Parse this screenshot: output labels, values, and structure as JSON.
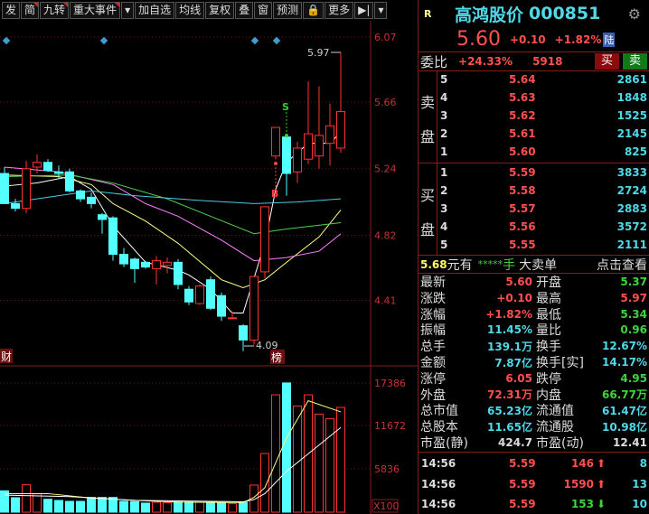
{
  "toolbar": {
    "items": [
      "发",
      "简",
      "九转",
      "重大事件",
      "▾",
      "加自选",
      "均线",
      "复权",
      "叠",
      "窗",
      "预测",
      "🔒",
      "更多",
      "▶|",
      "▾"
    ]
  },
  "stock": {
    "badge": "R",
    "name": "高鸿股价",
    "code": "000851",
    "price": "5.60",
    "change": "+0.10",
    "change_pct": "+1.82%",
    "tag": "陆"
  },
  "weibi": {
    "label": "委比",
    "pct": "+24.33%",
    "diff": "5918",
    "buy": "买",
    "sell": "卖"
  },
  "orderbook": {
    "sell_label": [
      "卖",
      "盘"
    ],
    "buy_label": [
      "买",
      "盘"
    ],
    "sell": [
      {
        "lvl": "5",
        "price": "5.64",
        "vol": "2861"
      },
      {
        "lvl": "4",
        "price": "5.63",
        "vol": "1848"
      },
      {
        "lvl": "3",
        "price": "5.62",
        "vol": "1525"
      },
      {
        "lvl": "2",
        "price": "5.61",
        "vol": "2145"
      },
      {
        "lvl": "1",
        "price": "5.60",
        "vol": "825"
      }
    ],
    "buy": [
      {
        "lvl": "1",
        "price": "5.59",
        "vol": "3833"
      },
      {
        "lvl": "2",
        "price": "5.58",
        "vol": "2724"
      },
      {
        "lvl": "3",
        "price": "5.57",
        "vol": "2883"
      },
      {
        "lvl": "4",
        "price": "5.56",
        "vol": "3572"
      },
      {
        "lvl": "5",
        "price": "5.55",
        "vol": "2111"
      }
    ]
  },
  "bigorder": {
    "price": "5.68",
    "text1": "元有",
    "stars": "*****",
    "text2": "手",
    "text3": "大卖单",
    "link": "点击查看"
  },
  "stats": [
    {
      "l1": "最新",
      "v1": "5.60",
      "c1": "red",
      "l2": "开盘",
      "v2": "5.37",
      "c2": "grn"
    },
    {
      "l1": "涨跌",
      "v1": "+0.10",
      "c1": "red",
      "l2": "最高",
      "v2": "5.97",
      "c2": "red"
    },
    {
      "l1": "涨幅",
      "v1": "+1.82%",
      "c1": "red",
      "l2": "最低",
      "v2": "5.34",
      "c2": "grn"
    },
    {
      "l1": "振幅",
      "v1": "11.45%",
      "c1": "cyan",
      "l2": "量比",
      "v2": "0.96",
      "c2": "grn"
    },
    {
      "l1": "总手",
      "v1": "139.1万",
      "c1": "cyan",
      "l2": "换手",
      "v2": "12.67%",
      "c2": "cyan"
    },
    {
      "l1": "金额",
      "v1": "7.87亿",
      "c1": "cyan",
      "l2": "换手[实]",
      "v2": "14.17%",
      "c2": "cyan"
    },
    {
      "l1": "涨停",
      "v1": "6.05",
      "c1": "red",
      "l2": "跌停",
      "v2": "4.95",
      "c2": "grn"
    },
    {
      "l1": "外盘",
      "v1": "72.31万",
      "c1": "red",
      "l2": "内盘",
      "v2": "66.77万",
      "c2": "grn"
    },
    {
      "l1": "总市值",
      "v1": "65.23亿",
      "c1": "cyan",
      "l2": "流通值",
      "v2": "61.47亿",
      "c2": "cyan"
    },
    {
      "l1": "总股本",
      "v1": "11.65亿",
      "c1": "cyan",
      "l2": "流通股",
      "v2": "10.98亿",
      "c2": "cyan"
    },
    {
      "l1": "市盈(静)",
      "v1": "424.7",
      "c1": "wht",
      "l2": "市盈(动)",
      "v2": "12.41",
      "c2": "wht"
    }
  ],
  "ticks": [
    {
      "time": "14:56",
      "price": "5.59",
      "vol": "146",
      "dir": "up",
      "n": "8"
    },
    {
      "time": "14:56",
      "price": "5.59",
      "vol": "1590",
      "dir": "up",
      "n": "13"
    },
    {
      "time": "14:56",
      "price": "5.59",
      "vol": "153",
      "dir": "down",
      "n": "10"
    }
  ],
  "colors": {
    "up": "#ff3232",
    "down": "#54ffff",
    "axis": "#c83232"
  },
  "chart_data": {
    "type": "candlestick",
    "price_ticks": [
      "6.07",
      "5.66",
      "5.24",
      "4.82",
      "4.41"
    ],
    "price_range": [
      4.0,
      6.07
    ],
    "high_label": "5.97",
    "low_label": "4.09",
    "signals": {
      "buy": "B",
      "sell": "S"
    },
    "markers": {
      "cai": "财",
      "bang": "榜"
    },
    "candles": [
      [
        5.21,
        5.25,
        5.02,
        5.02
      ],
      [
        5.02,
        5.05,
        4.97,
        4.99
      ],
      [
        4.99,
        5.29,
        4.96,
        5.24
      ],
      [
        5.25,
        5.33,
        5.21,
        5.28
      ],
      [
        5.28,
        5.3,
        5.22,
        5.23
      ],
      [
        5.22,
        5.26,
        5.18,
        5.21
      ],
      [
        5.22,
        5.24,
        5.09,
        5.1
      ],
      [
        5.1,
        5.11,
        5.03,
        5.05
      ],
      [
        5.06,
        5.09,
        4.99,
        5.02
      ],
      [
        4.95,
        4.96,
        4.83,
        4.92
      ],
      [
        4.93,
        4.94,
        4.66,
        4.7
      ],
      [
        4.7,
        4.74,
        4.62,
        4.64
      ],
      [
        4.67,
        4.68,
        4.52,
        4.61
      ],
      [
        4.65,
        4.66,
        4.61,
        4.62
      ],
      [
        4.61,
        4.69,
        4.51,
        4.66
      ],
      [
        4.63,
        4.68,
        4.58,
        4.65
      ],
      [
        4.65,
        4.67,
        4.48,
        4.51
      ],
      [
        4.48,
        4.5,
        4.38,
        4.4
      ],
      [
        4.39,
        4.51,
        4.38,
        4.5
      ],
      [
        4.54,
        4.56,
        4.35,
        4.36
      ],
      [
        4.44,
        4.46,
        4.28,
        4.31
      ],
      [
        4.3,
        4.34,
        4.3,
        4.3
      ],
      [
        4.25,
        4.26,
        4.09,
        4.16
      ],
      [
        4.16,
        4.56,
        4.13,
        4.56
      ],
      [
        4.59,
        5.0,
        4.55,
        5.0
      ],
      [
        5.32,
        5.5,
        5.3,
        5.5
      ],
      [
        5.44,
        5.45,
        5.07,
        5.21
      ],
      [
        5.22,
        5.41,
        5.15,
        5.37
      ],
      [
        5.3,
        5.79,
        5.27,
        5.46
      ],
      [
        5.32,
        5.76,
        5.24,
        5.45
      ],
      [
        5.4,
        5.65,
        5.26,
        5.51
      ],
      [
        5.37,
        5.97,
        5.34,
        5.6
      ]
    ],
    "ma": [
      {
        "name": "MA5",
        "color": "#ffffff",
        "pts": [
          [
            0,
            5.13
          ],
          [
            3,
            5.15
          ],
          [
            6,
            5.19
          ],
          [
            8,
            5.11
          ],
          [
            10,
            4.88
          ],
          [
            13,
            4.65
          ],
          [
            16,
            4.6
          ],
          [
            17,
            4.57
          ],
          [
            19,
            4.48
          ],
          [
            21,
            4.33
          ],
          [
            22,
            4.33
          ],
          [
            24,
            4.77
          ],
          [
            25,
            5.11
          ],
          [
            26,
            5.28
          ],
          [
            27,
            5.34
          ],
          [
            28,
            5.4
          ],
          [
            30,
            5.4
          ],
          [
            31,
            5.47
          ]
        ]
      },
      {
        "name": "MA10",
        "color": "#ffff80",
        "pts": [
          [
            0,
            5.2
          ],
          [
            5,
            5.19
          ],
          [
            8,
            5.14
          ],
          [
            10,
            5.02
          ],
          [
            13,
            4.91
          ],
          [
            16,
            4.77
          ],
          [
            20,
            4.54
          ],
          [
            22,
            4.49
          ],
          [
            24,
            4.54
          ],
          [
            26,
            4.65
          ],
          [
            29,
            4.81
          ],
          [
            31,
            4.98
          ]
        ]
      },
      {
        "name": "MA20",
        "color": "#ff80ff",
        "pts": [
          [
            0,
            5.25
          ],
          [
            5,
            5.22
          ],
          [
            10,
            5.14
          ],
          [
            13,
            5.02
          ],
          [
            16,
            4.94
          ],
          [
            20,
            4.79
          ],
          [
            23,
            4.66
          ],
          [
            26,
            4.68
          ],
          [
            29,
            4.72
          ],
          [
            31,
            4.83
          ]
        ]
      },
      {
        "name": "MA30",
        "color": "#50d050",
        "pts": [
          [
            0,
            5.19
          ],
          [
            6,
            5.2
          ],
          [
            10,
            5.15
          ],
          [
            15,
            5.05
          ],
          [
            19,
            4.94
          ],
          [
            23,
            4.83
          ],
          [
            26,
            4.86
          ],
          [
            31,
            4.9
          ]
        ]
      },
      {
        "name": "MA60",
        "color": "#50c8e8",
        "pts": [
          [
            0,
            5.02
          ],
          [
            4,
            5.06
          ],
          [
            8,
            5.1
          ],
          [
            12,
            5.07
          ],
          [
            18,
            5.04
          ],
          [
            23,
            5.02
          ],
          [
            27,
            5.03
          ],
          [
            31,
            5.05
          ]
        ]
      }
    ],
    "volume_ticks": [
      "17386",
      "11672",
      "5836"
    ],
    "volume_unit": "X100",
    "volume": [
      2880,
      1950,
      3690,
      2470,
      1740,
      1580,
      1460,
      1460,
      1990,
      1990,
      1990,
      1460,
      1420,
      1220,
      1340,
      1260,
      1380,
      1380,
      1340,
      1340,
      1260,
      1140,
      1340,
      3650,
      7900,
      15800,
      17400,
      14300,
      15800,
      13200,
      12600,
      14100
    ],
    "volume_ma": [
      {
        "name": "VMA5",
        "color": "#ffff80",
        "pts": [
          [
            0,
            2500
          ],
          [
            4,
            2500
          ],
          [
            8,
            1900
          ],
          [
            12,
            1600
          ],
          [
            16,
            1350
          ],
          [
            22,
            1300
          ],
          [
            23,
            2000
          ],
          [
            24,
            3300
          ],
          [
            26,
            10000
          ],
          [
            28,
            15000
          ],
          [
            31,
            13500
          ]
        ]
      },
      {
        "name": "VMA10",
        "color": "#ffffff",
        "pts": [
          [
            0,
            2300
          ],
          [
            6,
            2100
          ],
          [
            12,
            1600
          ],
          [
            22,
            1400
          ],
          [
            23,
            1700
          ],
          [
            24,
            2500
          ],
          [
            26,
            5500
          ],
          [
            31,
            11400
          ]
        ]
      }
    ]
  }
}
